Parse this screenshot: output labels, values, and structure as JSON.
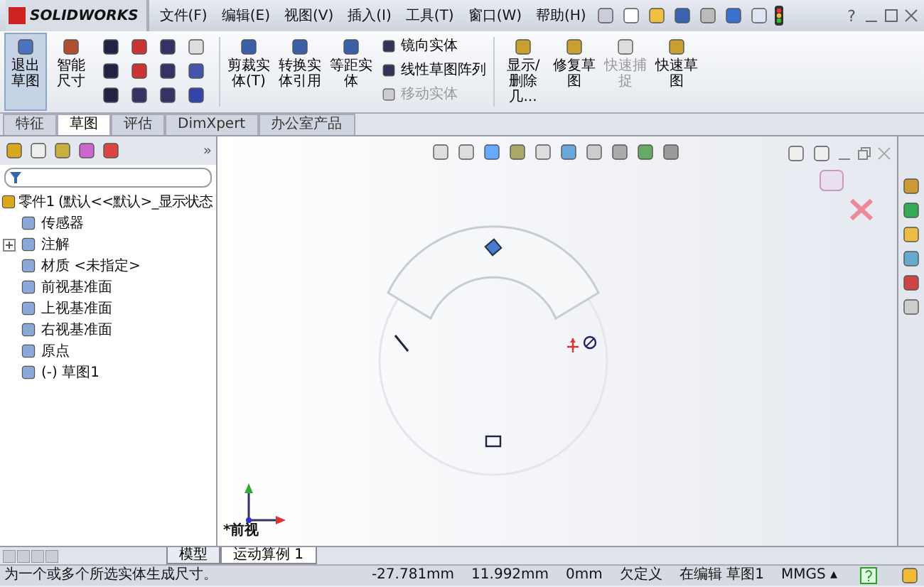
{
  "title_bar": {
    "logo": "SOLIDWORKS",
    "menus": [
      "文件(F)",
      "编辑(E)",
      "视图(V)",
      "插入(I)",
      "工具(T)",
      "窗口(W)",
      "帮助(H)"
    ],
    "help": "?"
  },
  "ribbon": {
    "big_buttons": [
      {
        "label": "退出草图",
        "selected": true
      },
      {
        "label": "智能尺寸",
        "selected": false
      }
    ],
    "mid_buttons": [
      {
        "label": "剪裁实体(T)"
      },
      {
        "label": "转换实体引用"
      },
      {
        "label": "等距实体"
      }
    ],
    "list_buttons": [
      {
        "label": "镜向实体",
        "disabled": false
      },
      {
        "label": "线性草图阵列",
        "disabled": false
      },
      {
        "label": "移动实体",
        "disabled": true
      }
    ],
    "end_buttons": [
      {
        "label": "显示/删除几...",
        "disabled": false
      },
      {
        "label": "修复草图",
        "disabled": false
      },
      {
        "label": "快速捕捉",
        "disabled": true
      },
      {
        "label": "快速草图",
        "disabled": false
      }
    ]
  },
  "tabs": [
    {
      "label": "特征",
      "selected": false
    },
    {
      "label": "草图",
      "selected": true
    },
    {
      "label": "评估",
      "selected": false
    },
    {
      "label": "DimXpert",
      "selected": false
    },
    {
      "label": "办公室产品",
      "selected": false
    }
  ],
  "panel": {
    "more": "»",
    "tree": [
      {
        "label": "零件1 (默认<<默认>_显示状态",
        "collapsed": false,
        "children": [
          {
            "label": "传感器",
            "collapsed": false
          },
          {
            "label": "注解",
            "collapsed": true
          },
          {
            "label": "材质 <未指定>",
            "collapsed": false
          },
          {
            "label": "前视基准面",
            "collapsed": false
          },
          {
            "label": "上视基准面",
            "collapsed": false
          },
          {
            "label": "右视基准面",
            "collapsed": false
          },
          {
            "label": "原点",
            "collapsed": false
          },
          {
            "label": "(-) 草图1",
            "collapsed": false
          }
        ]
      }
    ]
  },
  "view": {
    "label": "*前视"
  },
  "bottom_tabs": [
    {
      "label": "模型",
      "selected": false
    },
    {
      "label": "运动算例 1",
      "selected": true
    }
  ],
  "status_bar": {
    "message": "为一个或多个所选实体生成尺寸。",
    "fields": [
      "-27.781mm",
      "11.992mm",
      "0mm",
      "欠定义",
      "在编辑 草图1"
    ],
    "units": "MMGS ▴"
  }
}
